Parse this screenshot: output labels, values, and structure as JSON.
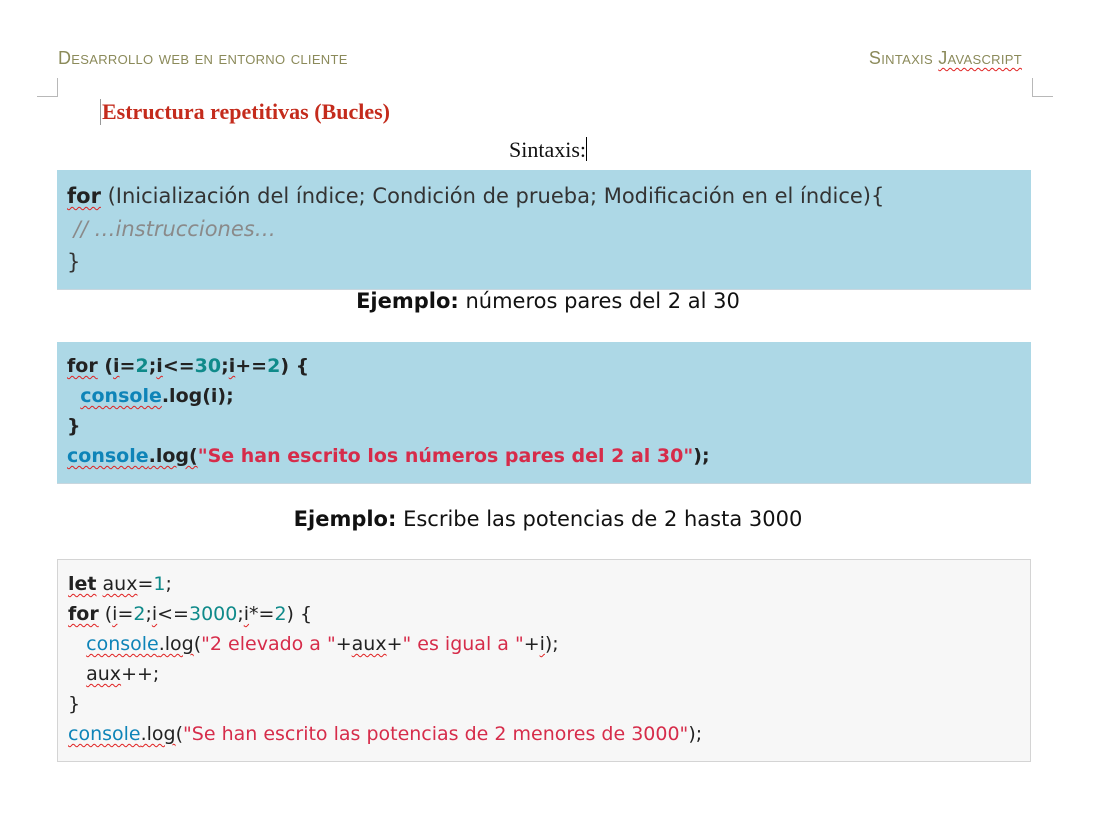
{
  "header": {
    "left": "Desarrollo web en entorno cliente",
    "right_prefix": "Sintaxis ",
    "right_word": "Javascript"
  },
  "section_title": "Estructura repetitivas (Bucles)",
  "sintaxis_label": "Sintaxis:",
  "syntax_block": {
    "kw_for": "for",
    "line1_rest": " (Inicialización del índice; Condición de prueba; Modificación en el índice){",
    "line2": " // …instrucciones…",
    "line3": "}"
  },
  "example1": {
    "label": "Ejemplo:",
    "text": " números pares del 2 al 30",
    "code": {
      "kw_for": "for",
      "l1_a": " (",
      "var_i": "i",
      "l1_b": "=",
      "n_2": "2",
      "l1_c": ";",
      "l1_d": "<=",
      "n_30": "30",
      "l1_e": ";",
      "l1_f": "+=",
      "l1_g": ") {",
      "indent": "  ",
      "console": "console",
      "log_a": ".log(i);",
      "close": "}",
      "log_b": ".log(",
      "str": "\"Se han escrito los números pares del 2 al 30\"",
      "end": ");"
    }
  },
  "example2": {
    "label": "Ejemplo:",
    "text": " Escribe las potencias de 2 hasta 3000",
    "code": {
      "kw_let": "let",
      "var_aux": "aux",
      "eq": "=",
      "n_1": "1",
      "semi": ";",
      "kw_for": "for",
      "l2_a": " (",
      "var_i": "i",
      "n_2": "2",
      "le": "<=",
      "n_3000": "3000",
      "mul": "*=",
      "l2_end": ") {",
      "indent": "   ",
      "console": "console",
      "dot_log": ".log",
      "paren": "(",
      "str_a": "\"2 elevado a \"",
      "plus": "+",
      "str_b": "\" es igual a \"",
      "close_call": ");",
      "incr": "++;",
      "close": "}",
      "str_final": "\"Se han escrito las potencias de 2 menores de 3000\""
    }
  },
  "colors": {
    "title": "#c42b1c",
    "header": "#8b8a5a",
    "code_bg_blue": "#add8e6",
    "code_bg_grey": "#f7f7f7",
    "string": "#d62c4a",
    "number": "#0f8a8a",
    "object": "#0e84b8"
  }
}
